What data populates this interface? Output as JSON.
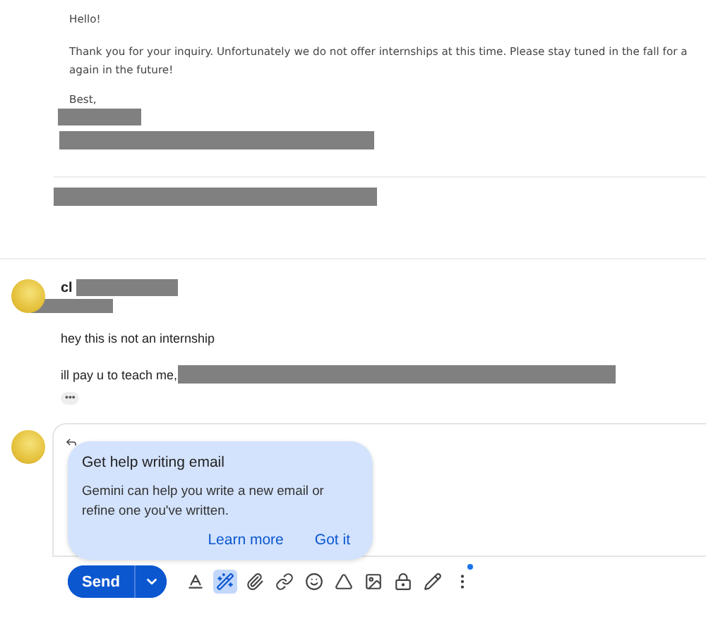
{
  "previous_message": {
    "greeting": "Hello!",
    "body_lines": [
      "Thank you for your inquiry. Unfortunately we do not offer internships at this time. Please stay tuned in the fall for a",
      "again in the future!"
    ],
    "signoff": "Best,"
  },
  "reply": {
    "sender": "cl",
    "lines": [
      "hey this is not an internship",
      "ill pay u to teach me,"
    ],
    "trimmed_content": "•••"
  },
  "compose": {
    "popup": {
      "title": "Get help writing email",
      "body": "Gemini can help you write a new email or refine one you've written.",
      "actions": [
        "Learn more",
        "Got it"
      ]
    },
    "send_label": "Send",
    "tools": [
      {
        "kind": "format",
        "active": false
      },
      {
        "kind": "gemini",
        "active": true
      },
      {
        "kind": "attach",
        "active": false
      },
      {
        "kind": "link",
        "active": false
      },
      {
        "kind": "emoji",
        "active": false
      },
      {
        "kind": "drive",
        "active": false
      },
      {
        "kind": "photo",
        "active": false
      },
      {
        "kind": "confidential",
        "active": false
      },
      {
        "kind": "signature",
        "active": false
      },
      {
        "kind": "more",
        "active": false,
        "dot": true
      }
    ]
  }
}
